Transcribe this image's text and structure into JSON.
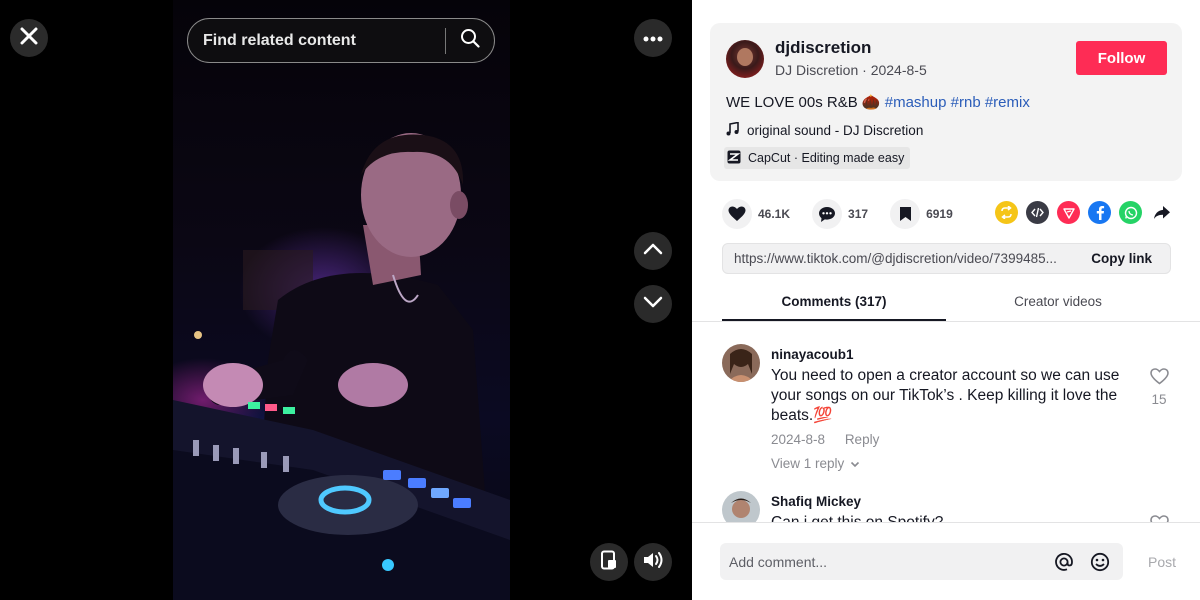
{
  "video": {
    "search_placeholder": "Find related content"
  },
  "author": {
    "username": "djdiscretion",
    "display_name": "DJ Discretion",
    "date": "2024-8-5",
    "follow_label": "Follow"
  },
  "post": {
    "caption_text": "WE LOVE 00s R&B",
    "caption_emoji": "🌰",
    "hashtags": [
      "#mashup",
      "#rnb",
      "#remix"
    ],
    "sound": "original sound - DJ Discretion",
    "capcut": "CapCut · Editing made easy"
  },
  "stats": {
    "likes": "46.1K",
    "comments": "317",
    "saves": "6919"
  },
  "share": {
    "url": "https://www.tiktok.com/@djdiscretion/video/7399485...",
    "copy_label": "Copy link",
    "colors": {
      "repost": "#f5c518",
      "embed": "#161823",
      "send": "#fe2c55",
      "facebook": "#1877f2",
      "whatsapp": "#25d366"
    }
  },
  "tabs": {
    "comments": "Comments (317)",
    "creator": "Creator videos"
  },
  "comments": [
    {
      "user": "ninayacoub1",
      "text": "You need to open a creator account so we can use your songs on our TikTok’s . Keep killing it love the beats.💯",
      "date": "2024-8-8",
      "reply_label": "Reply",
      "replies_label": "View 1 reply",
      "likes": "15"
    },
    {
      "user": "Shafiq Mickey",
      "text": "Can i get this on Spotify?"
    }
  ],
  "composer": {
    "placeholder": "Add comment...",
    "post_label": "Post"
  },
  "colors": {
    "accent": "#fe2c55",
    "hashtag": "#2b5db9"
  }
}
